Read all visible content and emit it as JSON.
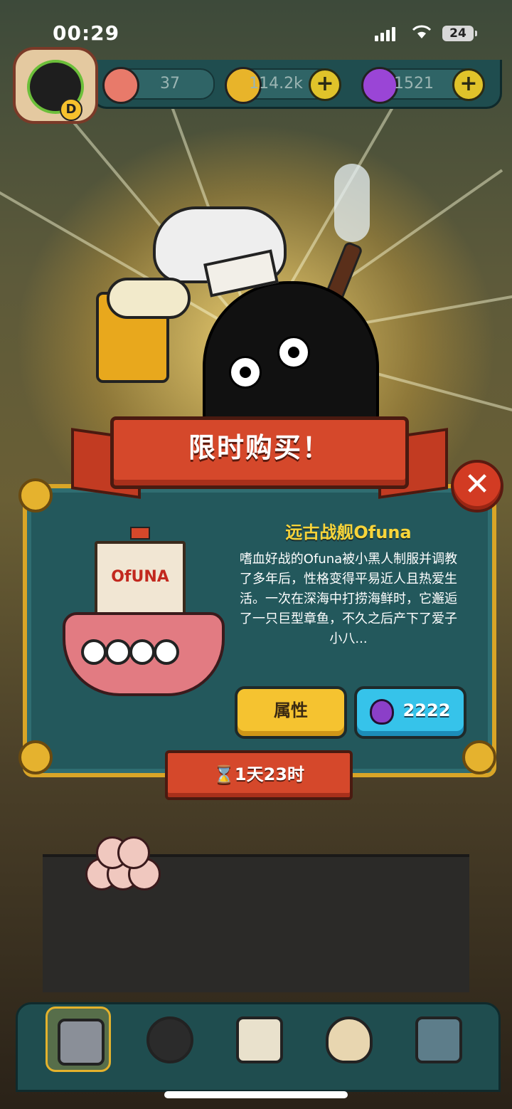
{
  "status_bar": {
    "time": "00:29",
    "battery": "24"
  },
  "header": {
    "avatar_letter": "D",
    "resources": [
      {
        "icon": "eyeball-icon",
        "value": "37"
      },
      {
        "icon": "coin-icon",
        "value": "114.2k"
      },
      {
        "icon": "potion-icon",
        "value": "1521"
      }
    ],
    "plus_label": "+"
  },
  "banner": {
    "title": "限时购买！"
  },
  "offer": {
    "title": "远古战舰Ofuna",
    "sail_text": "OfUNA",
    "description": "嗜血好战的Ofuna被小黑人制服并调教了多年后，性格变得平易近人且热爱生活。一次在深海中打捞海鲜时，它邂逅了一只巨型章鱼，不久之后产下了爱子小八...",
    "attribute_button": "属性",
    "price": "2222",
    "timer": "⌛1天23时",
    "close_label": "✕"
  },
  "nav": {
    "items": [
      "shop-icon",
      "monster-icon",
      "book-icon",
      "money-bag-icon",
      "grid-icon"
    ],
    "active_index": 0
  },
  "colors": {
    "panel": "#23585c",
    "banner": "#d5482b",
    "gold": "#f5c330",
    "blue_button": "#36c3ea",
    "title_yellow": "#f7d43a"
  }
}
